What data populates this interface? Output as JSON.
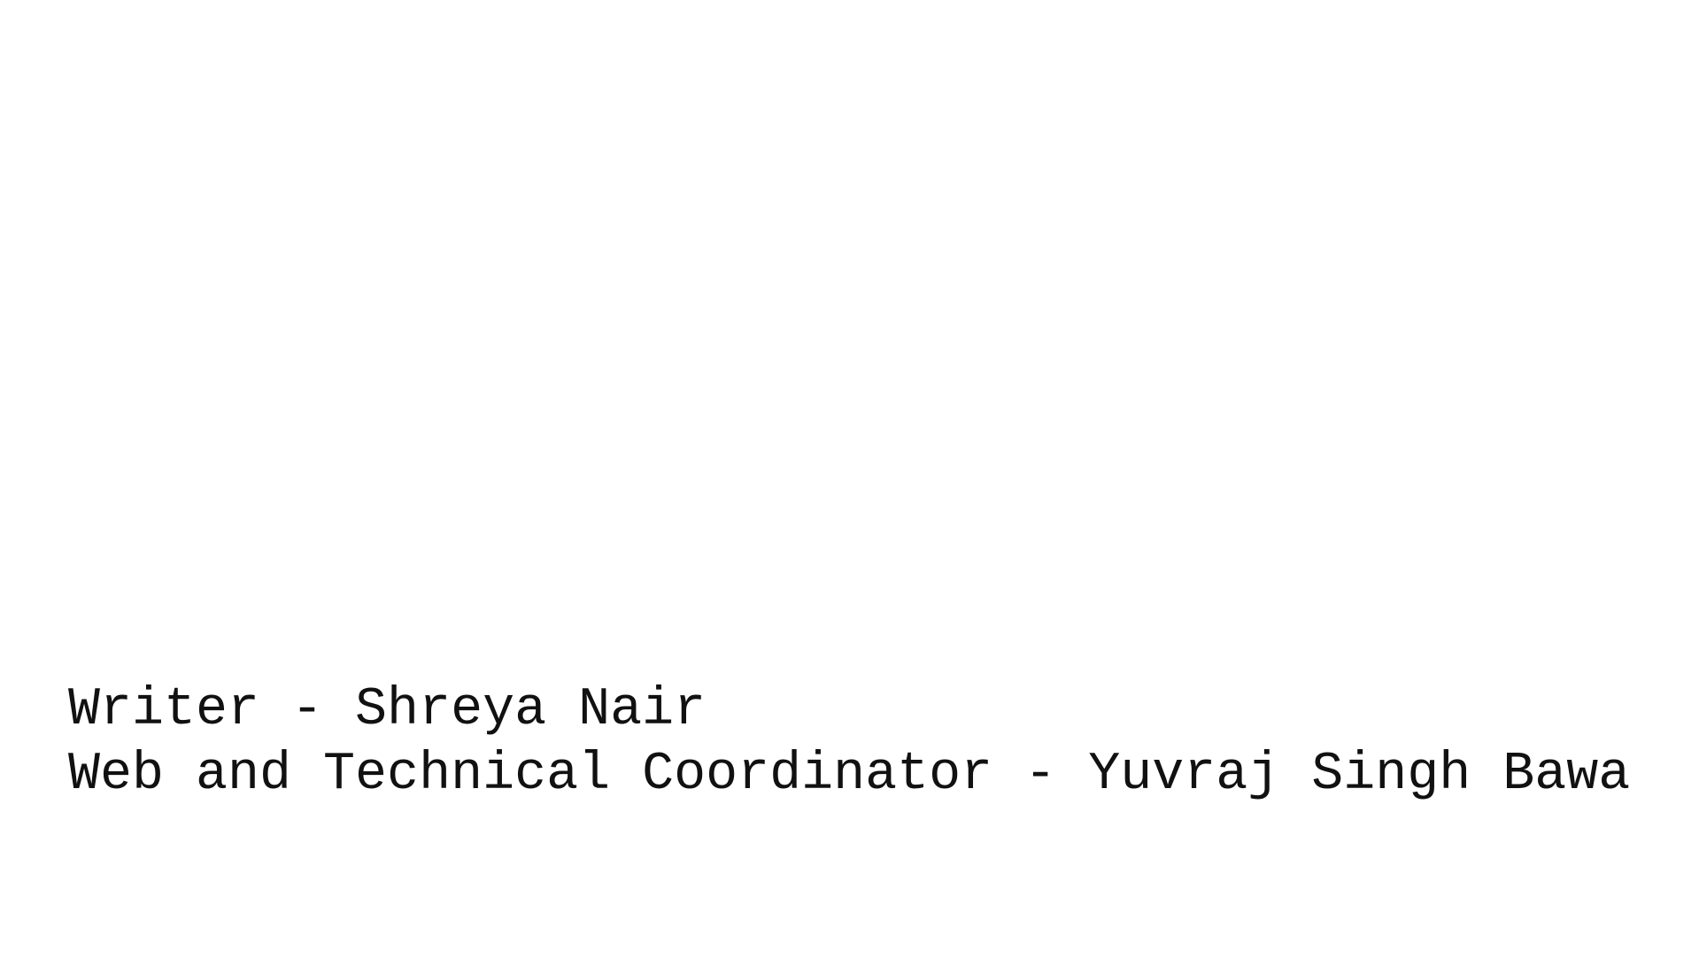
{
  "credits": [
    "Writer - Shreya Nair",
    "Web and Technical Coordinator - Yuvraj Singh Bawa"
  ]
}
